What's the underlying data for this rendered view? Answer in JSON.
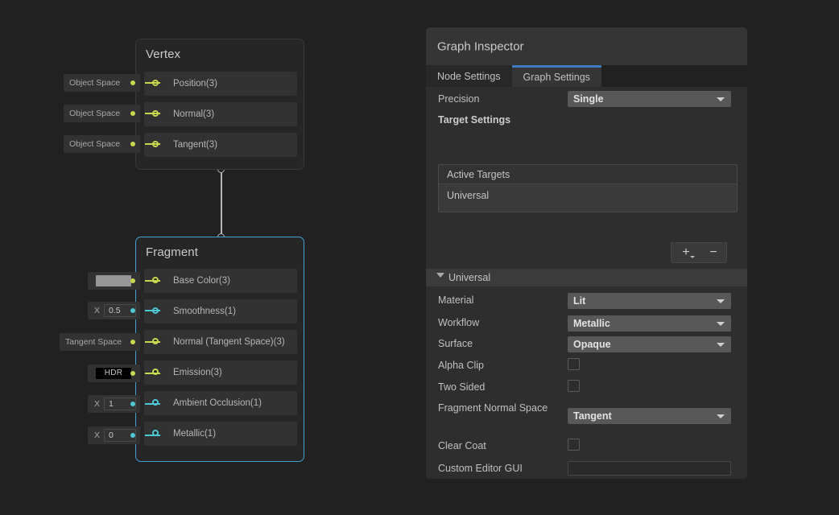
{
  "canvas": {
    "background": "#212121"
  },
  "nodes": {
    "vertex": {
      "title": "Vertex",
      "ports": [
        {
          "label": "Position(3)",
          "slot": "Object Space",
          "type": "vec",
          "color": "#c8d94f"
        },
        {
          "label": "Normal(3)",
          "slot": "Object Space",
          "type": "vec",
          "color": "#c8d94f"
        },
        {
          "label": "Tangent(3)",
          "slot": "Object Space",
          "type": "vec",
          "color": "#c8d94f"
        }
      ]
    },
    "fragment": {
      "title": "Fragment",
      "selected_border": "#44a0d4",
      "ports": [
        {
          "label": "Base Color(3)",
          "type": "vec",
          "color": "#c8d94f",
          "widget": "color",
          "swatch": "#969696"
        },
        {
          "label": "Smoothness(1)",
          "type": "flt",
          "color": "#4ec9d4",
          "widget": "number",
          "axis": "X",
          "value": "0.5"
        },
        {
          "label": "Normal (Tangent Space)(3)",
          "type": "vec",
          "color": "#c8d94f",
          "widget": "chip",
          "slot": "Tangent Space"
        },
        {
          "label": "Emission(3)",
          "type": "vec",
          "color": "#c8d94f",
          "widget": "hdr",
          "hdr_label": "HDR"
        },
        {
          "label": "Ambient Occlusion(1)",
          "type": "flt",
          "color": "#4ec9d4",
          "widget": "number",
          "axis": "X",
          "value": "1"
        },
        {
          "label": "Metallic(1)",
          "type": "flt",
          "color": "#4ec9d4",
          "widget": "number",
          "axis": "X",
          "value": "0"
        }
      ]
    }
  },
  "inspector": {
    "title": "Graph Inspector",
    "tabs": [
      {
        "label": "Node Settings",
        "active": false
      },
      {
        "label": "Graph Settings",
        "active": true
      }
    ],
    "active_tab_accent": "#3e79c0",
    "precision": {
      "label": "Precision",
      "value": "Single"
    },
    "target_settings": {
      "label": "Target Settings",
      "list_header": "Active Targets",
      "items": [
        "Universal"
      ],
      "add_button": "+",
      "remove_button": "−"
    },
    "universal": {
      "foldout_label": "Universal",
      "fields": [
        {
          "label": "Material",
          "type": "dropdown",
          "value": "Lit"
        },
        {
          "label": "Workflow",
          "type": "dropdown",
          "value": "Metallic"
        },
        {
          "label": "Surface",
          "type": "dropdown",
          "value": "Opaque"
        },
        {
          "label": "Alpha Clip",
          "type": "checkbox",
          "checked": false
        },
        {
          "label": "Two Sided",
          "type": "checkbox",
          "checked": false
        },
        {
          "label": "Fragment Normal Space",
          "type": "dropdown",
          "value": "Tangent"
        },
        {
          "label": "Clear Coat",
          "type": "checkbox",
          "checked": false
        },
        {
          "label": "Custom Editor GUI",
          "type": "textfield",
          "value": ""
        }
      ]
    }
  }
}
